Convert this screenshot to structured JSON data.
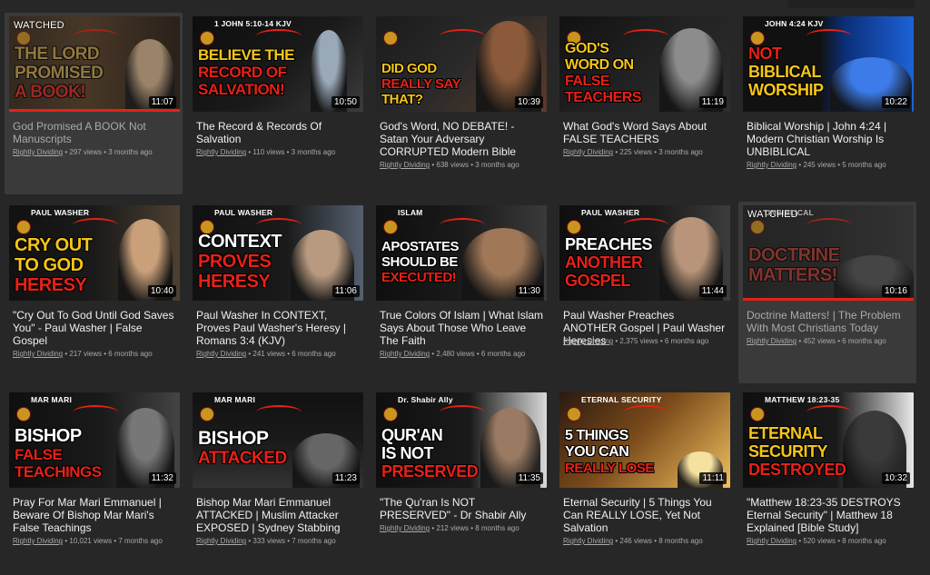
{
  "channel": "Rightly Dividing",
  "watched_label": "WATCHED",
  "colors": {
    "accent": "#e62117",
    "background": "#272727",
    "gold": "#f5c518"
  },
  "videos": [
    {
      "title": "God Promised A BOOK Not Manuscripts",
      "views": "297 views",
      "age": "3 months ago",
      "duration": "11:07",
      "watched": true,
      "progress": 1.0,
      "thumb_lines": [
        "THE LORD",
        "PROMISED",
        "A BOOK!"
      ],
      "thumb_tag": ""
    },
    {
      "title": "The Record & Records Of Salvation",
      "views": "110 views",
      "age": "3 months ago",
      "duration": "10:50",
      "watched": false,
      "thumb_lines": [
        "BELIEVE THE",
        "RECORD OF",
        "SALVATION!"
      ],
      "thumb_tag": "1 JOHN 5:10-14 KJV"
    },
    {
      "title": "God's Word, NO DEBATE! - Satan Your Adversary CORRUPTED Modern Bible",
      "views": "638 views",
      "age": "3 months ago",
      "duration": "10:39",
      "watched": false,
      "thumb_lines": [
        "DID GOD",
        "REALLY SAY",
        "THAT?"
      ],
      "thumb_tag": ""
    },
    {
      "title": "What God's Word Says About FALSE TEACHERS",
      "views": "225 views",
      "age": "3 months ago",
      "duration": "11:19",
      "watched": false,
      "thumb_lines": [
        "GOD'S",
        "WORD ON",
        "FALSE",
        "TEACHERS"
      ],
      "thumb_tag": ""
    },
    {
      "title": "Biblical Worship | John 4:24 | Modern Christian Worship Is UNBIBLICAL",
      "views": "245 views",
      "age": "5 months ago",
      "duration": "10:22",
      "watched": false,
      "thumb_lines": [
        "NOT",
        "BIBLICAL",
        "WORSHIP"
      ],
      "thumb_tag": "JOHN 4:24 KJV"
    },
    {
      "title": "\"Cry Out To God Until God Saves You\" - Paul Washer | False Gospel",
      "views": "217 views",
      "age": "6 months ago",
      "duration": "10:40",
      "watched": false,
      "thumb_lines": [
        "CRY OUT",
        "TO GOD",
        "HERESY"
      ],
      "thumb_tag": "PAUL WASHER"
    },
    {
      "title": "Paul Washer In CONTEXT, Proves Paul Washer's Heresy | Romans 3:4 (KJV)",
      "views": "241 views",
      "age": "6 months ago",
      "duration": "11:06",
      "watched": false,
      "thumb_lines": [
        "CONTEXT",
        "PROVES",
        "HERESY"
      ],
      "thumb_tag": "PAUL WASHER"
    },
    {
      "title": "True Colors Of Islam | What Islam Says About Those Who Leave The Faith",
      "views": "2,480 views",
      "age": "6 months ago",
      "duration": "11:30",
      "watched": false,
      "thumb_lines": [
        "APOSTATES",
        "SHOULD BE",
        "EXECUTED!"
      ],
      "thumb_tag": "ISLAM"
    },
    {
      "title": "Paul Washer Preaches ANOTHER Gospel | Paul Washer Heresies",
      "views": "2,375 views",
      "age": "6 months ago",
      "duration": "11:44",
      "watched": false,
      "thumb_lines": [
        "PREACHES",
        "ANOTHER",
        "GOSPEL"
      ],
      "thumb_tag": "PAUL WASHER"
    },
    {
      "title": "Doctrine Matters! | The Problem With Most Christians Today",
      "views": "452 views",
      "age": "6 months ago",
      "duration": "10:16",
      "watched": true,
      "progress": 1.0,
      "thumb_lines": [
        "DOCTRINE",
        "MATTERS!"
      ],
      "thumb_tag": "UNBIBLICAL"
    },
    {
      "title": "Pray For Mar Mari Emmanuel | Beware Of Bishop Mar Mari's False Teachings",
      "views": "10,021 views",
      "age": "7 months ago",
      "duration": "11:32",
      "watched": false,
      "thumb_lines": [
        "BISHOP",
        "FALSE",
        "TEACHINGS"
      ],
      "thumb_tag": "MAR MARI"
    },
    {
      "title": "Bishop Mar Mari Emmanuel ATTACKED | Muslim Attacker EXPOSED | Sydney Stabbing",
      "views": "333 views",
      "age": "7 months ago",
      "duration": "11:23",
      "watched": false,
      "thumb_lines": [
        "BISHOP",
        "ATTACKED"
      ],
      "thumb_tag": "MAR MARI"
    },
    {
      "title": "\"The Qu'ran Is NOT PRESERVED\" - Dr Shabir Ally",
      "views": "212 views",
      "age": "8 months ago",
      "duration": "11:35",
      "watched": false,
      "thumb_lines": [
        "QUR'AN",
        "IS NOT",
        "PRESERVED"
      ],
      "thumb_tag": "Dr. Shabir Ally"
    },
    {
      "title": "Eternal Security | 5 Things You Can REALLY LOSE, Yet Not Salvation",
      "views": "246 views",
      "age": "8 months ago",
      "duration": "11:11",
      "watched": false,
      "thumb_lines": [
        "5 THINGS",
        "YOU CAN",
        "REALLY LOSE"
      ],
      "thumb_tag": "ETERNAL SECURITY"
    },
    {
      "title": "\"Matthew 18:23-35 DESTROYS Eternal Security\" | Matthew 18 Explained [Bible Study]",
      "views": "520 views",
      "age": "8 months ago",
      "duration": "10:32",
      "watched": false,
      "thumb_lines": [
        "ETERNAL",
        "SECURITY",
        "DESTROYED"
      ],
      "thumb_tag": "MATTHEW 18:23-35"
    }
  ]
}
